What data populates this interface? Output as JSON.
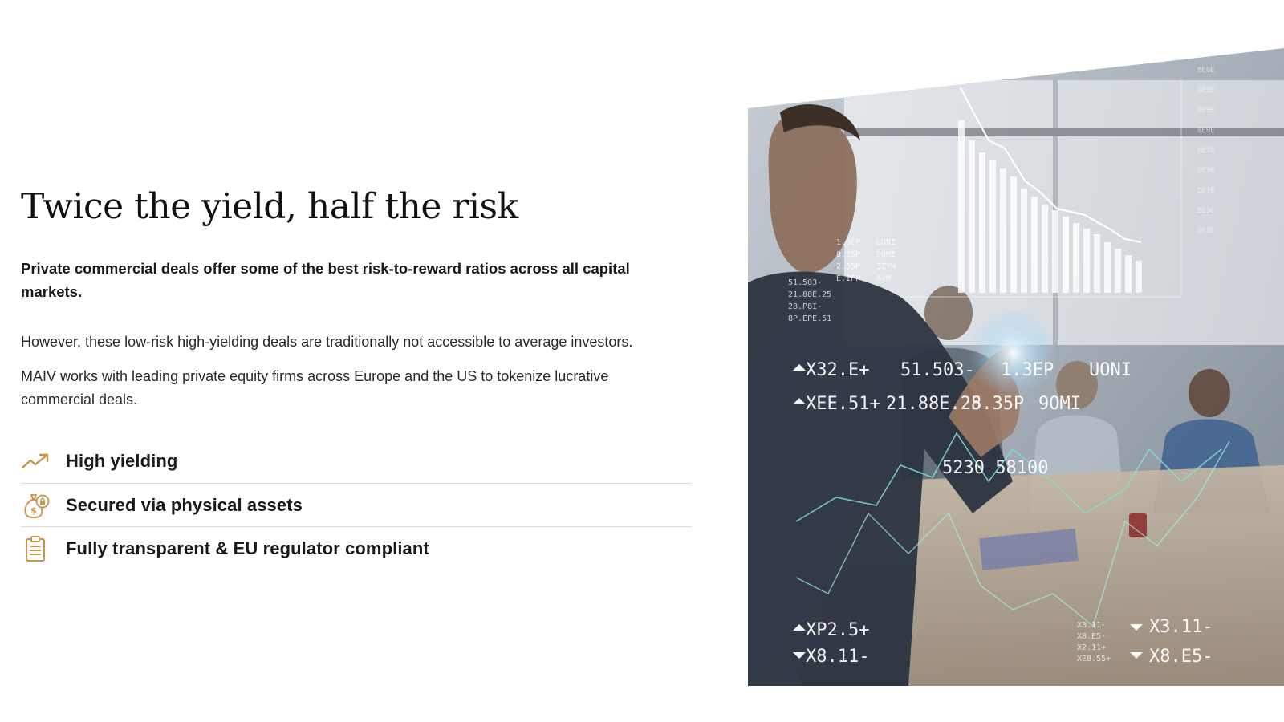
{
  "section": {
    "headline": "Twice the yield, half the risk",
    "lead": "Private commercial deals offer some of the best risk-to-reward ratios across all capital markets.",
    "paragraphs": [
      "However, these low-risk high-yielding deals are traditionally not accessible to average investors.",
      "MAIV works with leading private equity firms across Europe and the US to tokenize lucrative commercial deals."
    ],
    "features": [
      {
        "label": "High yielding",
        "icon": "trending-up-icon"
      },
      {
        "label": "Secured via physical assets",
        "icon": "money-bag-lock-icon"
      },
      {
        "label": "Fully transparent & EU regulator compliant",
        "icon": "clipboard-icon"
      }
    ]
  },
  "hero_image": {
    "alt": "Businessman touching a transparent screen with financial charts in a meeting room",
    "overlay_figures": [
      {
        "text": "X32.E+",
        "dir": "up"
      },
      {
        "text": "51.503-",
        "dir": "none"
      },
      {
        "text": "1.3EP",
        "dir": "none"
      },
      {
        "text": "UONI",
        "dir": "none"
      },
      {
        "text": "XEE.51+",
        "dir": "up"
      },
      {
        "text": "21.88E.25",
        "dir": "none"
      },
      {
        "text": "8.35P",
        "dir": "none"
      },
      {
        "text": "9OMI",
        "dir": "none"
      },
      {
        "text": "5230 58100",
        "dir": "none"
      },
      {
        "text": "XP2.5+",
        "dir": "up"
      },
      {
        "text": "X8.11-",
        "dir": "down"
      },
      {
        "text": "X3.11-",
        "dir": "down"
      },
      {
        "text": "X8.E5-",
        "dir": "down"
      }
    ]
  },
  "colors": {
    "accent": "#c8934a",
    "text": "#1c1c1c",
    "divider": "#dcdcdc"
  }
}
